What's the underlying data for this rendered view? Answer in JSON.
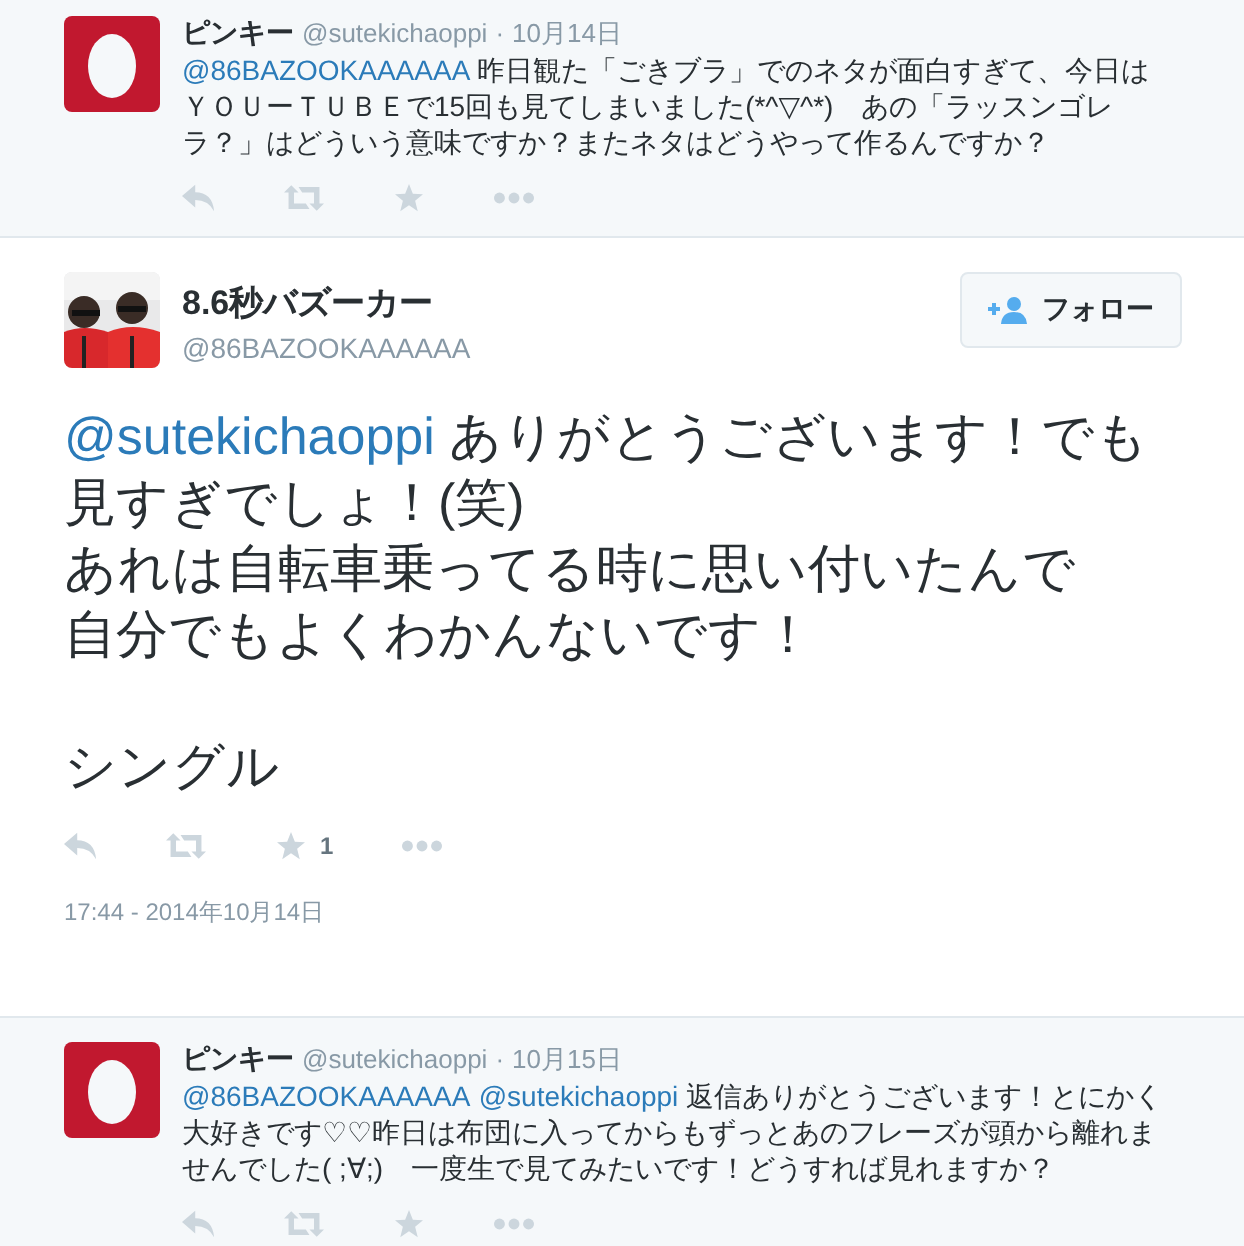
{
  "previous_tweet": {
    "name": "ピンキー",
    "handle": "@sutekichaoppi",
    "separator": "·",
    "date": "10月14日",
    "parts": [
      {
        "kind": "mention",
        "text": "@86BAZOOKAAAAAA"
      },
      {
        "kind": "text",
        "text": " 昨日観た「ごきブラ」でのネタが面白すぎて、今日はＹＯＵーＴＵＢＥで15回も見てしまいました(*^▽^*)　あの「ラッスンゴレラ？」はどういう意味ですか？またネタはどうやって作るんですか？"
      }
    ]
  },
  "main_tweet": {
    "name": "8.6秒バズーカー",
    "handle": "@86BAZOOKAAAAAA",
    "follow_button": "フォロー",
    "paragraphs": [
      {
        "spaced": false,
        "parts": [
          {
            "kind": "mention",
            "text": "@sutekichaoppi"
          },
          {
            "kind": "text",
            "text": " ありがとうございます！でも見すぎでしょ！(笑)"
          }
        ]
      },
      {
        "spaced": false,
        "parts": [
          {
            "kind": "text",
            "text": "あれは自転車乗ってる時に思い付いたんで"
          }
        ]
      },
      {
        "spaced": false,
        "parts": [
          {
            "kind": "text",
            "text": "自分でもよくわかんないです！"
          }
        ]
      },
      {
        "spaced": true,
        "parts": [
          {
            "kind": "text",
            "text": "シングル"
          }
        ]
      }
    ],
    "favorite_count": "1",
    "timestamp": "17:44 - 2014年10月14日"
  },
  "next_tweet": {
    "name": "ピンキー",
    "handle": "@sutekichaoppi",
    "separator": "·",
    "date": "10月15日",
    "parts": [
      {
        "kind": "mention",
        "text": "@86BAZOOKAAAAAA"
      },
      {
        "kind": "mention",
        "text": "@sutekichaoppi"
      },
      {
        "kind": "text",
        "text": " 返信ありがとうございます！とにかく大好きです♡♡昨日は布団に入ってからもずっとあのフレーズが頭から離れませんでした( ;∀;)　一度生で見てみたいです！どうすれば見れますか？"
      }
    ]
  }
}
